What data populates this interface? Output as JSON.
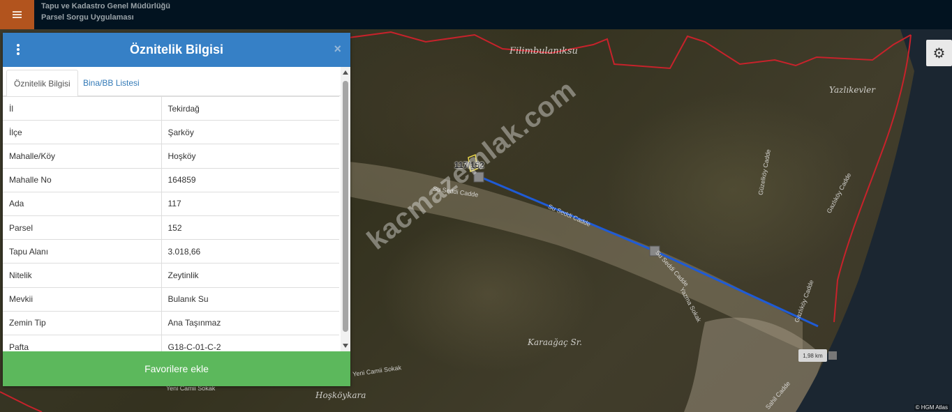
{
  "header": {
    "org_name": "Tapu ve Kadastro Genel Müdürlüğü",
    "app_name": "Parsel Sorgu Uygulaması",
    "menu_icon": "hamburger-icon"
  },
  "panel": {
    "title": "Öznitelik Bilgisi",
    "menu_icon": "kebab-icon",
    "close_label": "×",
    "tabs": [
      {
        "label": "Öznitelik Bilgisi",
        "active": true
      },
      {
        "label": "Bina/BB Listesi",
        "active": false
      }
    ],
    "rows": [
      {
        "key": "İl",
        "value": "Tekirdağ"
      },
      {
        "key": "İlçe",
        "value": "Şarköy"
      },
      {
        "key": "Mahalle/Köy",
        "value": "Hoşköy"
      },
      {
        "key": "Mahalle No",
        "value": "164859"
      },
      {
        "key": "Ada",
        "value": "117"
      },
      {
        "key": "Parsel",
        "value": "152"
      },
      {
        "key": "Tapu Alanı",
        "value": "3.018,66"
      },
      {
        "key": "Nitelik",
        "value": "Zeytinlik"
      },
      {
        "key": "Mevkii",
        "value": "Bulanık Su"
      },
      {
        "key": "Zemin Tip",
        "value": "Ana Taşınmaz"
      },
      {
        "key": "Pafta",
        "value": "G18-C-01-C-2"
      }
    ],
    "favorite_button": "Favorilere ekle"
  },
  "map": {
    "settings_icon": "gear-icon",
    "settings_glyph": "⚙",
    "parcel_label": "117/152",
    "measure_label": "1,98 km",
    "watermark": "kacmazemlak.com",
    "attribution": "© HGM Atlas",
    "place_labels": [
      "Filimbulanıksu",
      "Yazlıkevler",
      "Karaağaç Sr.",
      "Hoşköykara"
    ],
    "street_labels": [
      "Su Seddi Cadde",
      "Su Seddi Cadde",
      "Su Seddi Cadde",
      "Güzelköy Cadde",
      "Gazlıköy Cadde",
      "Gazlıköy Cadde",
      "Yazma Sokak",
      "Yeni Camii Sokak",
      "Yeni Camii Sokak",
      "Sahil Cadde"
    ],
    "colors": {
      "boundary": "#c8222b",
      "measure_line": "#1f5bd6",
      "sea": "#1b2631"
    }
  }
}
